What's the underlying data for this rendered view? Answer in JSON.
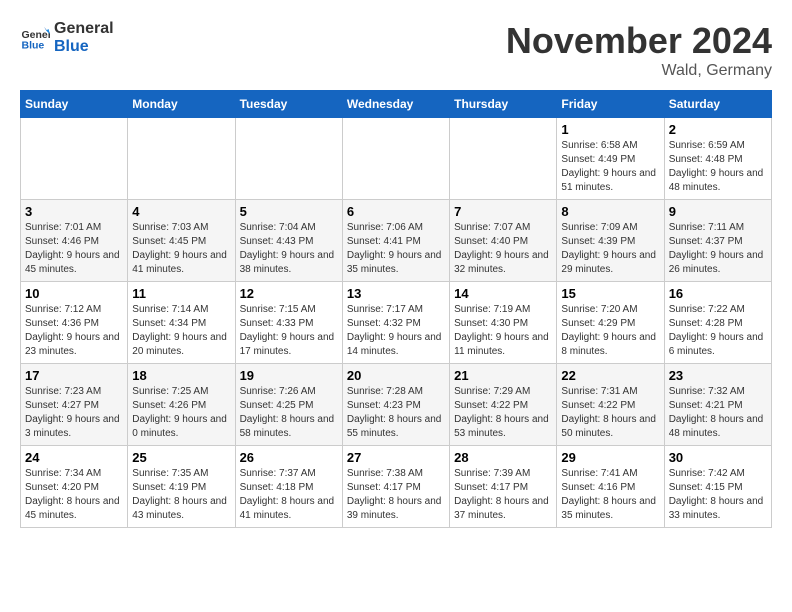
{
  "logo": {
    "text_general": "General",
    "text_blue": "Blue"
  },
  "header": {
    "month": "November 2024",
    "location": "Wald, Germany"
  },
  "weekdays": [
    "Sunday",
    "Monday",
    "Tuesday",
    "Wednesday",
    "Thursday",
    "Friday",
    "Saturday"
  ],
  "weeks": [
    [
      {
        "day": "",
        "info": ""
      },
      {
        "day": "",
        "info": ""
      },
      {
        "day": "",
        "info": ""
      },
      {
        "day": "",
        "info": ""
      },
      {
        "day": "",
        "info": ""
      },
      {
        "day": "1",
        "info": "Sunrise: 6:58 AM\nSunset: 4:49 PM\nDaylight: 9 hours and 51 minutes."
      },
      {
        "day": "2",
        "info": "Sunrise: 6:59 AM\nSunset: 4:48 PM\nDaylight: 9 hours and 48 minutes."
      }
    ],
    [
      {
        "day": "3",
        "info": "Sunrise: 7:01 AM\nSunset: 4:46 PM\nDaylight: 9 hours and 45 minutes."
      },
      {
        "day": "4",
        "info": "Sunrise: 7:03 AM\nSunset: 4:45 PM\nDaylight: 9 hours and 41 minutes."
      },
      {
        "day": "5",
        "info": "Sunrise: 7:04 AM\nSunset: 4:43 PM\nDaylight: 9 hours and 38 minutes."
      },
      {
        "day": "6",
        "info": "Sunrise: 7:06 AM\nSunset: 4:41 PM\nDaylight: 9 hours and 35 minutes."
      },
      {
        "day": "7",
        "info": "Sunrise: 7:07 AM\nSunset: 4:40 PM\nDaylight: 9 hours and 32 minutes."
      },
      {
        "day": "8",
        "info": "Sunrise: 7:09 AM\nSunset: 4:39 PM\nDaylight: 9 hours and 29 minutes."
      },
      {
        "day": "9",
        "info": "Sunrise: 7:11 AM\nSunset: 4:37 PM\nDaylight: 9 hours and 26 minutes."
      }
    ],
    [
      {
        "day": "10",
        "info": "Sunrise: 7:12 AM\nSunset: 4:36 PM\nDaylight: 9 hours and 23 minutes."
      },
      {
        "day": "11",
        "info": "Sunrise: 7:14 AM\nSunset: 4:34 PM\nDaylight: 9 hours and 20 minutes."
      },
      {
        "day": "12",
        "info": "Sunrise: 7:15 AM\nSunset: 4:33 PM\nDaylight: 9 hours and 17 minutes."
      },
      {
        "day": "13",
        "info": "Sunrise: 7:17 AM\nSunset: 4:32 PM\nDaylight: 9 hours and 14 minutes."
      },
      {
        "day": "14",
        "info": "Sunrise: 7:19 AM\nSunset: 4:30 PM\nDaylight: 9 hours and 11 minutes."
      },
      {
        "day": "15",
        "info": "Sunrise: 7:20 AM\nSunset: 4:29 PM\nDaylight: 9 hours and 8 minutes."
      },
      {
        "day": "16",
        "info": "Sunrise: 7:22 AM\nSunset: 4:28 PM\nDaylight: 9 hours and 6 minutes."
      }
    ],
    [
      {
        "day": "17",
        "info": "Sunrise: 7:23 AM\nSunset: 4:27 PM\nDaylight: 9 hours and 3 minutes."
      },
      {
        "day": "18",
        "info": "Sunrise: 7:25 AM\nSunset: 4:26 PM\nDaylight: 9 hours and 0 minutes."
      },
      {
        "day": "19",
        "info": "Sunrise: 7:26 AM\nSunset: 4:25 PM\nDaylight: 8 hours and 58 minutes."
      },
      {
        "day": "20",
        "info": "Sunrise: 7:28 AM\nSunset: 4:23 PM\nDaylight: 8 hours and 55 minutes."
      },
      {
        "day": "21",
        "info": "Sunrise: 7:29 AM\nSunset: 4:22 PM\nDaylight: 8 hours and 53 minutes."
      },
      {
        "day": "22",
        "info": "Sunrise: 7:31 AM\nSunset: 4:22 PM\nDaylight: 8 hours and 50 minutes."
      },
      {
        "day": "23",
        "info": "Sunrise: 7:32 AM\nSunset: 4:21 PM\nDaylight: 8 hours and 48 minutes."
      }
    ],
    [
      {
        "day": "24",
        "info": "Sunrise: 7:34 AM\nSunset: 4:20 PM\nDaylight: 8 hours and 45 minutes."
      },
      {
        "day": "25",
        "info": "Sunrise: 7:35 AM\nSunset: 4:19 PM\nDaylight: 8 hours and 43 minutes."
      },
      {
        "day": "26",
        "info": "Sunrise: 7:37 AM\nSunset: 4:18 PM\nDaylight: 8 hours and 41 minutes."
      },
      {
        "day": "27",
        "info": "Sunrise: 7:38 AM\nSunset: 4:17 PM\nDaylight: 8 hours and 39 minutes."
      },
      {
        "day": "28",
        "info": "Sunrise: 7:39 AM\nSunset: 4:17 PM\nDaylight: 8 hours and 37 minutes."
      },
      {
        "day": "29",
        "info": "Sunrise: 7:41 AM\nSunset: 4:16 PM\nDaylight: 8 hours and 35 minutes."
      },
      {
        "day": "30",
        "info": "Sunrise: 7:42 AM\nSunset: 4:15 PM\nDaylight: 8 hours and 33 minutes."
      }
    ]
  ]
}
